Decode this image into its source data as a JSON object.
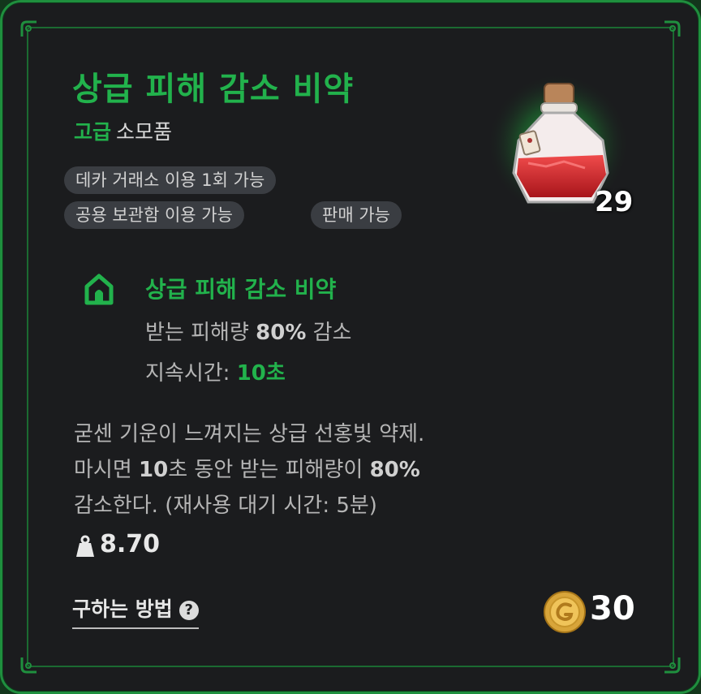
{
  "item": {
    "name": "상급 피해 감소 비약",
    "grade": "고급",
    "category": "소모품",
    "stack_count": "29",
    "icon": "red-potion-icon"
  },
  "tags": [
    "데카 거래소 이용 1회 가능",
    "공용 보관함 이용 가능",
    "판매 가능"
  ],
  "effect": {
    "icon": "house-icon",
    "name": "상급 피해 감소 비약",
    "line1_prefix": "받는 피해량 ",
    "line1_value": "80%",
    "line1_suffix": " 감소",
    "line2_label": "지속시간: ",
    "line2_value": "10초"
  },
  "description": {
    "line1": "굳센 기운이 느껴지는 상급 선홍빛 약제.",
    "line2_a": "마시면 ",
    "line2_b": "10",
    "line2_c": "초 동안 받는 피해량이 ",
    "line2_d": "80%",
    "line3": "감소한다. (재사용 대기 시간: 5분)"
  },
  "weight": {
    "icon": "weight-icon",
    "value": "8.70"
  },
  "acquire": {
    "label": "구하는 방법",
    "icon": "question-icon"
  },
  "price": {
    "icon": "gold-coin-icon",
    "value": "30"
  },
  "colors": {
    "accent_green": "#22b24c",
    "background": "#1b1c1e",
    "tag_bg": "#3a3d42"
  }
}
